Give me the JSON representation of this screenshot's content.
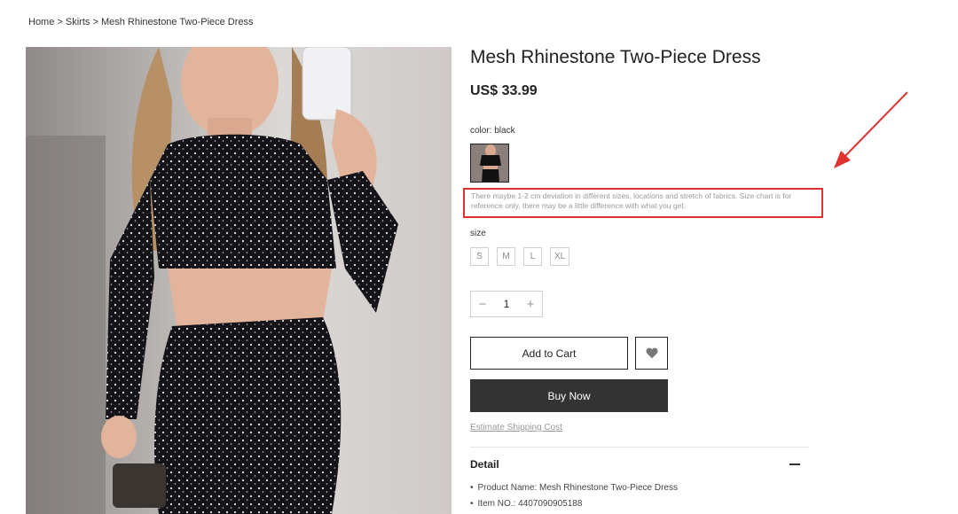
{
  "breadcrumb": {
    "home": "Home",
    "separator": " > ",
    "category": "Skirts",
    "current": "Mesh Rhinestone Two-Piece Dress"
  },
  "product": {
    "title": "Mesh Rhinestone Two-Piece Dress",
    "price": "US$ 33.99",
    "color_label": "color: black",
    "notice": "There maybe 1-2 cm deviation in different sizes, locations and stretch of fabrics. Size chart is for reference only, there may be a little difference with what you get.",
    "size_label": "size",
    "sizes": [
      "S",
      "M",
      "L",
      "XL"
    ],
    "quantity": "1",
    "quantity_minus": "−",
    "quantity_plus": "+"
  },
  "actions": {
    "add_to_cart": "Add to Cart",
    "buy_now": "Buy Now",
    "shipping_link": "Estimate Shipping Cost"
  },
  "detail": {
    "title": "Detail",
    "items": [
      {
        "label": "Product Name: ",
        "value": "Mesh Rhinestone Two-Piece Dress"
      },
      {
        "label": "Item NO.: ",
        "value": "4407090905188"
      }
    ]
  },
  "colors": {
    "annotation": "#e0322f",
    "buy_now_bg": "#333333",
    "muted_text": "#9a9a9a"
  },
  "icons": {
    "wishlist": "heart-icon",
    "annotation": "red-arrow-icon"
  }
}
